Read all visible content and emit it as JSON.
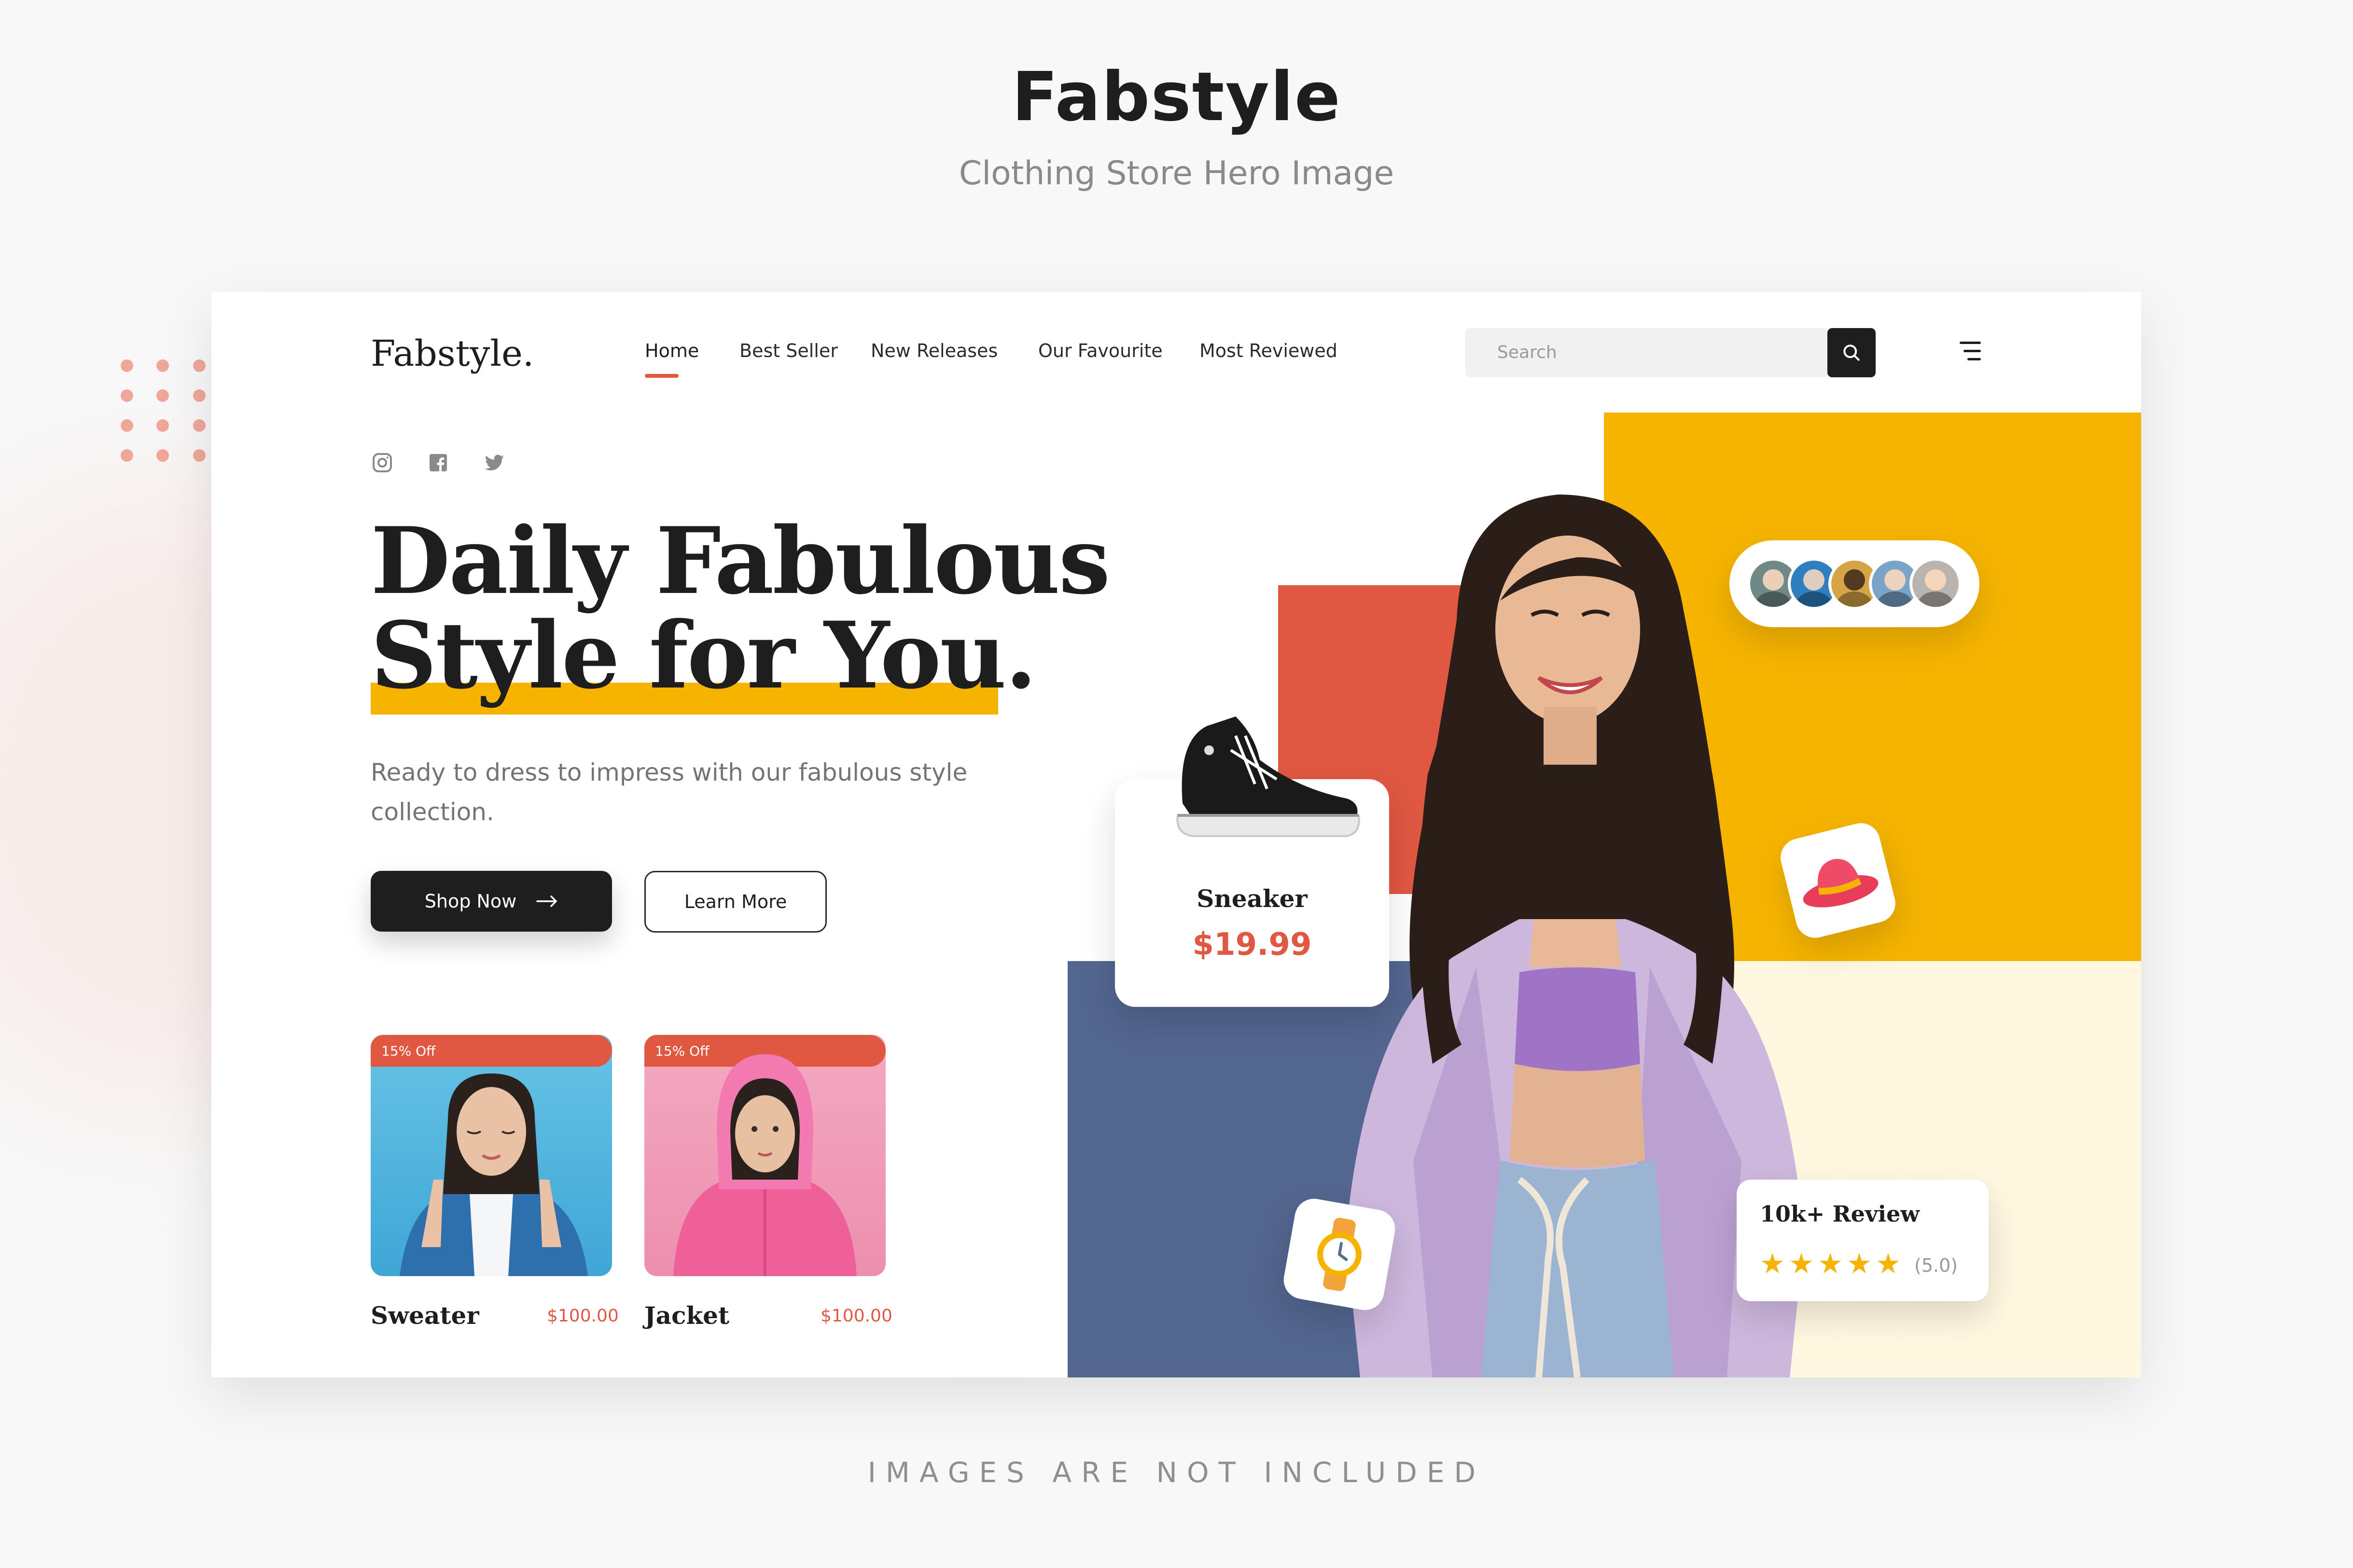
{
  "presentation": {
    "title": "Fabstyle",
    "subtitle": "Clothing Store Hero Image",
    "footer": "IMAGES ARE NOT INCLUDED"
  },
  "header": {
    "logo": "Fabstyle.",
    "nav": [
      {
        "label": "Home",
        "active": true
      },
      {
        "label": "Best Seller",
        "active": false
      },
      {
        "label": "New Releases",
        "active": false
      },
      {
        "label": "Our Favourite",
        "active": false
      },
      {
        "label": "Most Reviewed",
        "active": false
      }
    ],
    "search": {
      "placeholder": "Search"
    }
  },
  "social": [
    "instagram-icon",
    "facebook-icon",
    "twitter-icon"
  ],
  "hero": {
    "headline_line1": "Daily Fabulous",
    "headline_line2": "Style for You",
    "headline_period": ".",
    "lead": "Ready to dress to impress with our fabulous style collection.",
    "primary_button": "Shop Now",
    "secondary_button": "Learn More"
  },
  "products": [
    {
      "name": "Sweater",
      "price": "$100.00",
      "badge": "15% Off"
    },
    {
      "name": "Jacket",
      "price": "$100.00",
      "badge": "15% Off"
    }
  ],
  "showcase": {
    "sneaker": {
      "name": "Sneaker",
      "price": "$19.99"
    },
    "review": {
      "title": "10k+ Review",
      "stars": "★★★★★",
      "rating": "(5.0)"
    },
    "avatar_count": 5
  },
  "colors": {
    "accent": "#e05842",
    "yellow": "#f6b400",
    "dark": "#1e1e1e",
    "blue": "#53668f"
  }
}
